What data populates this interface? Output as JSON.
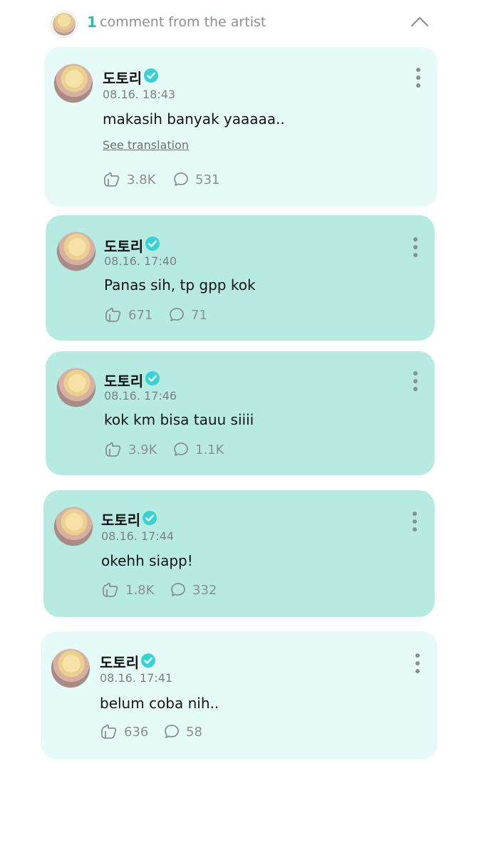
{
  "header": {
    "count": "1",
    "label": "comment from the artist"
  },
  "comments": [
    {
      "author": "도토리",
      "time": "08.16. 18:43",
      "text": "makasih banyak yaaaaa..",
      "translate": "See translation",
      "likes": "3.8K",
      "replies": "531"
    },
    {
      "author": "도토리",
      "time": "08.16. 17:40",
      "text": "Panas sih, tp gpp kok",
      "likes": "671",
      "replies": "71"
    },
    {
      "author": "도토리",
      "time": "08.16. 17:46",
      "text": "kok km bisa tauu siiii",
      "likes": "3.9K",
      "replies": "1.1K"
    },
    {
      "author": "도토리",
      "time": "08.16. 17:44",
      "text": "okehh siapp!",
      "likes": "1.8K",
      "replies": "332"
    },
    {
      "author": "도토리",
      "time": "08.16. 17:41",
      "text": "belum coba nih..",
      "likes": "636",
      "replies": "58"
    }
  ],
  "colors": {
    "accent": "#2bb7b3",
    "card_light": "#e6fbf7",
    "card_mid": "#b7ebe2",
    "badge": "#37d2d6"
  },
  "icons": [
    "avatar",
    "verified-badge-icon",
    "more-vertical-icon",
    "chevron-up-icon",
    "like-icon",
    "comment-icon"
  ]
}
